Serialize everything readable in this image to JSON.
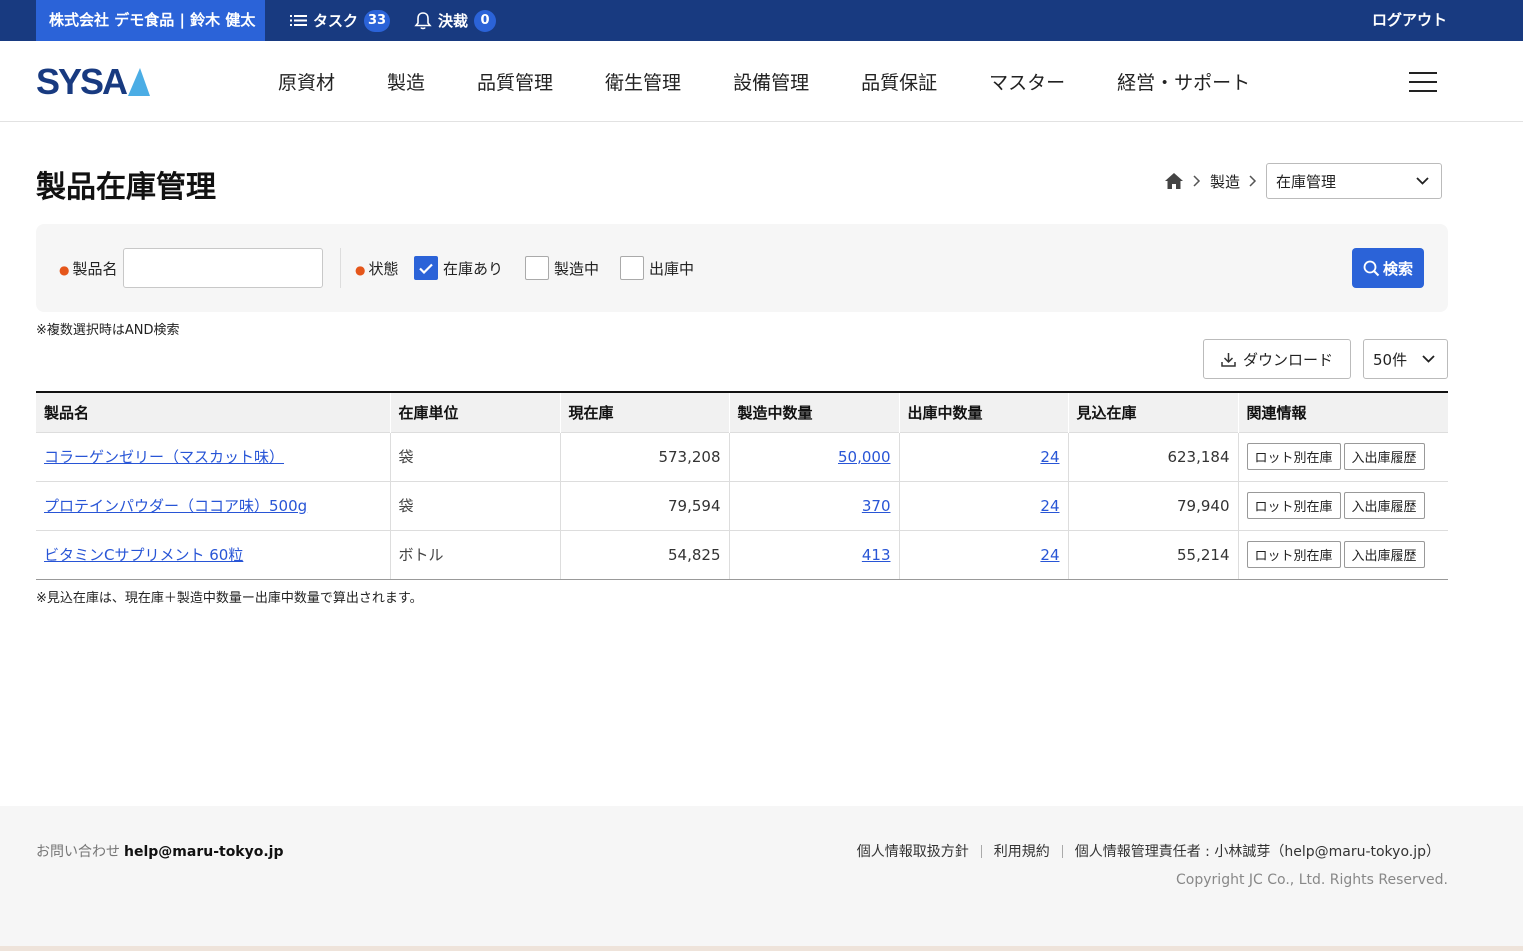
{
  "topbar": {
    "company_user": "株式会社 デモ食品 | 鈴木 健太",
    "task_label": "タスク",
    "task_count": "33",
    "approval_label": "決裁",
    "approval_count": "0",
    "logout": "ログアウト"
  },
  "nav": {
    "logo_text": "SYSA",
    "items": [
      "原資材",
      "製造",
      "品質管理",
      "衛生管理",
      "設備管理",
      "品質保証",
      "マスター",
      "経営・サポート"
    ]
  },
  "page": {
    "title": "製品在庫管理",
    "breadcrumb_parent": "製造",
    "breadcrumb_current": "在庫管理"
  },
  "search": {
    "product_label": "製品名",
    "product_value": "",
    "status_label": "状態",
    "options": [
      {
        "label": "在庫あり",
        "checked": true
      },
      {
        "label": "製造中",
        "checked": false
      },
      {
        "label": "出庫中",
        "checked": false
      }
    ],
    "search_button": "検索",
    "note": "※複数選択時はAND検索"
  },
  "toolbar": {
    "download": "ダウンロード",
    "per_page": "50件"
  },
  "table": {
    "headers": [
      "製品名",
      "在庫単位",
      "現在庫",
      "製造中数量",
      "出庫中数量",
      "見込在庫",
      "関連情報"
    ],
    "rows": [
      {
        "name": "コラーゲンゼリー（マスカット味）",
        "unit": "袋",
        "stock": "573,208",
        "manufacturing": "50,000",
        "shipping": "24",
        "projected": "623,184"
      },
      {
        "name": "プロテインパウダー（ココア味）500g",
        "unit": "袋",
        "stock": "79,594",
        "manufacturing": "370",
        "shipping": "24",
        "projected": "79,940"
      },
      {
        "name": "ビタミンCサプリメント 60粒",
        "unit": "ボトル",
        "stock": "54,825",
        "manufacturing": "413",
        "shipping": "24",
        "projected": "55,214"
      }
    ],
    "lot_button": "ロット別在庫",
    "history_button": "入出庫履歴",
    "note": "※見込在庫は、現在庫＋製造中数量ー出庫中数量で算出されます。"
  },
  "footer": {
    "contact_label": "お問い合わせ",
    "contact_email": "help@maru-tokyo.jp",
    "links": [
      "個人情報取扱方針",
      "利用規約",
      "個人情報管理責任者 : 小林誠芽（help@maru-tokyo.jp）"
    ],
    "copyright": "Copyright JC Co., Ltd. Rights Reserved."
  },
  "colors": {
    "topbar": "#183a80",
    "accent": "#2b63d8",
    "link": "#2855d6"
  }
}
